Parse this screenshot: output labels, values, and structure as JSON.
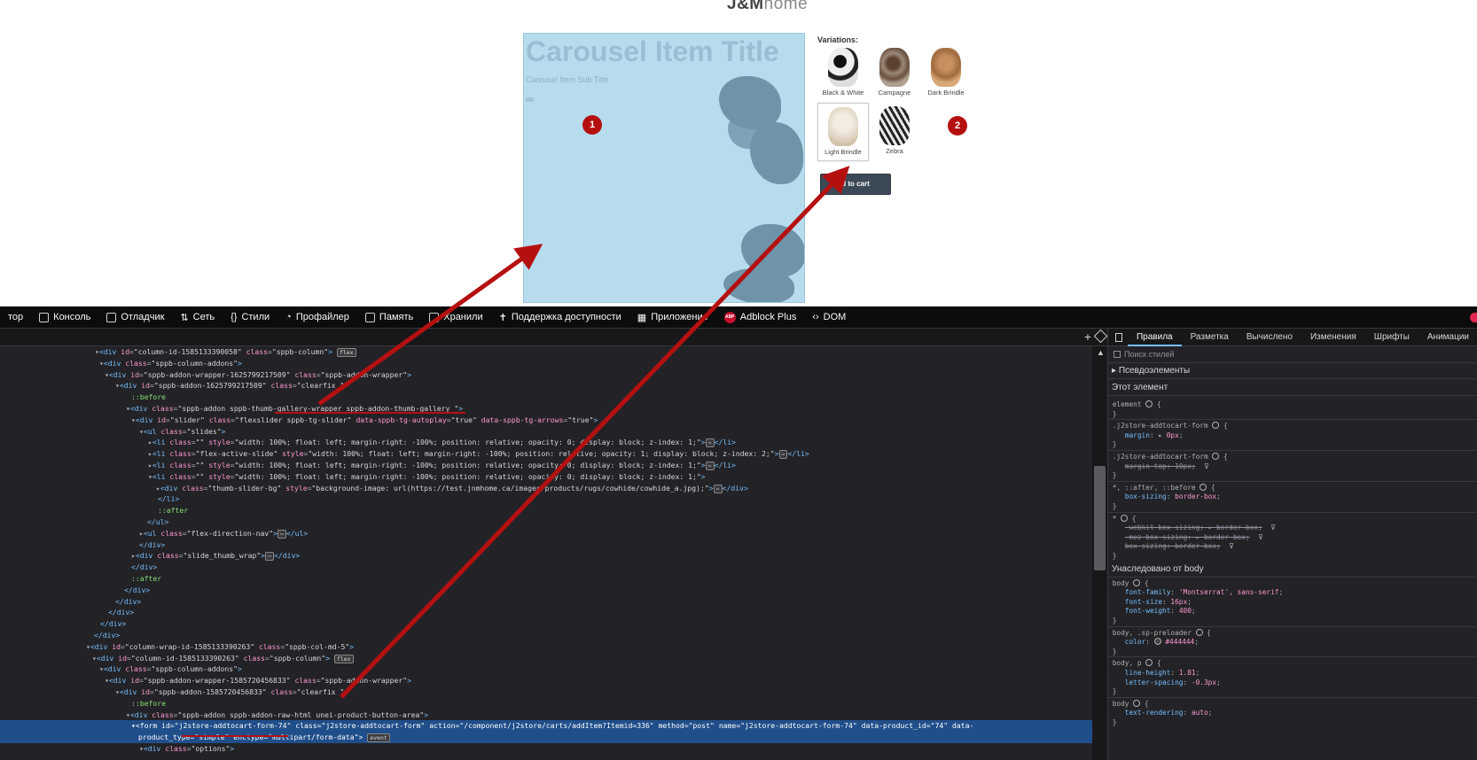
{
  "page": {
    "logo_main": "J&M",
    "logo_sub": "home",
    "carousel": {
      "title": "Carousel Item Title",
      "subtitle": "Carousel Item Sub Title"
    },
    "markers": [
      "1",
      "2"
    ],
    "variations_label": "Variations:",
    "variations": [
      {
        "name": "Black & White",
        "selected": false
      },
      {
        "name": "Campagne",
        "selected": false
      },
      {
        "name": "Dark Brindle",
        "selected": false
      },
      {
        "name": "Light Brindle",
        "selected": true
      },
      {
        "name": "Zebra",
        "selected": false
      }
    ],
    "add_to_cart": "d to cart"
  },
  "toolbar": {
    "items": [
      {
        "label": "тор",
        "icon": "inspector-icon"
      },
      {
        "label": "Консоль",
        "icon": "console-icon"
      },
      {
        "label": "Отладчик",
        "icon": "debugger-icon"
      },
      {
        "label": "Сеть",
        "icon": "network-icon"
      },
      {
        "label": "Стили",
        "icon": "style-editor-icon"
      },
      {
        "label": "Профайлер",
        "icon": "profiler-icon"
      },
      {
        "label": "Память",
        "icon": "memory-icon"
      },
      {
        "label": "Хранили",
        "icon": "storage-icon"
      },
      {
        "label": "Поддержка доступности",
        "icon": "accessibility-icon"
      },
      {
        "label": "Приложение",
        "icon": "application-icon"
      },
      {
        "label": "Adblock Plus",
        "icon": "adblock-icon"
      },
      {
        "label": "DOM",
        "icon": "dom-icon"
      }
    ]
  },
  "rules_panel": {
    "tabs": [
      "Правила",
      "Разметка",
      "Вычислено",
      "Изменения",
      "Шрифты",
      "Анимации"
    ],
    "active_tab": "Правила",
    "filter_placeholder": "Поиск стилей",
    "pseudo_elements": "Псевдоэлементы",
    "this_element": "Этот элемент",
    "inherited_from": "Унаследовано от body",
    "color_value": "#444444"
  }
}
